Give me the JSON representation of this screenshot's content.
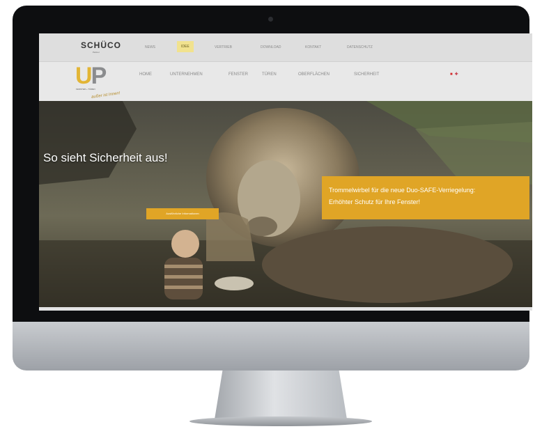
{
  "brand": {
    "top_logo": "SCHÜCO",
    "top_logo_sub": "Partner",
    "main_logo_u": "U",
    "main_logo_p": "P",
    "main_logo_sub": "FENSTER + TÜREN",
    "main_logo_slogan": "außer ist Innen!"
  },
  "top_nav": [
    "News",
    "Idee",
    "Vertrieb",
    "Download",
    "Kontakt",
    "Datenschutz"
  ],
  "main_nav": [
    "Home",
    "Unternehmen",
    "Fenster",
    "Türen",
    "Oberflächen",
    "Sicherheit"
  ],
  "language_flags": [
    "DE",
    "EN"
  ],
  "hero": {
    "headline": "So sieht Sicherheit aus!",
    "cta_label": "Ausführliche Informationen",
    "promo_line1": "Trommelwirbel für die neue Duo-SAFE-Verriegelung:",
    "promo_line2": "Erhöhter Schutz für Ihre Fenster!"
  },
  "colors": {
    "accent": "#e0a526",
    "logo_yellow": "#e2b535",
    "logo_grey": "#8b8c8e"
  }
}
